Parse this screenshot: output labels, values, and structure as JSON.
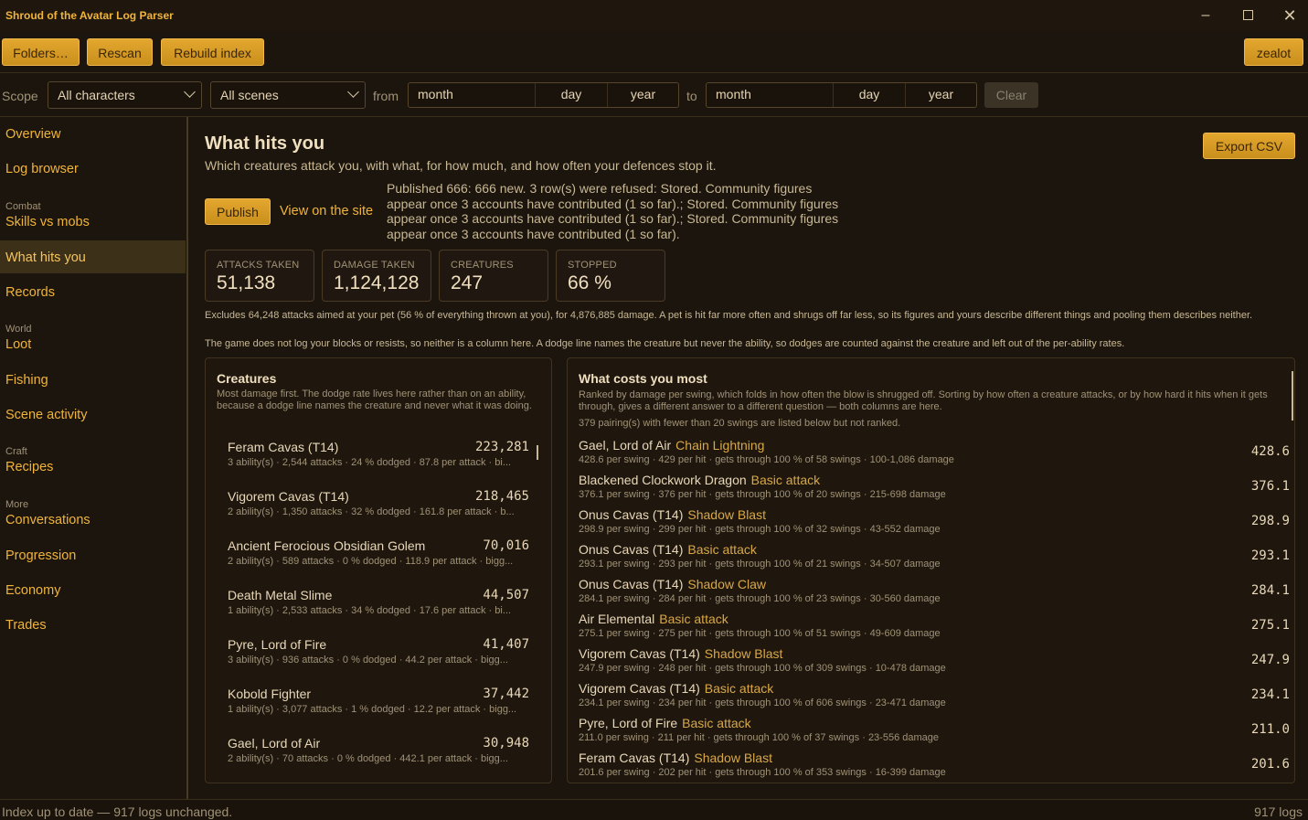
{
  "app": {
    "title": "Shroud of the Avatar Log Parser"
  },
  "toolbar": {
    "folders": "Folders…",
    "rescan": "Rescan",
    "rebuild": "Rebuild index",
    "user": "zealot"
  },
  "filters": {
    "scope_label": "Scope",
    "characters": "All characters",
    "scenes": "All scenes",
    "from_label": "from",
    "to_label": "to",
    "month": "month",
    "day": "day",
    "year": "year",
    "clear": "Clear"
  },
  "sidebar": {
    "overview": "Overview",
    "log_browser": "Log browser",
    "group_combat": "Combat",
    "skills_vs_mobs": "Skills vs mobs",
    "what_hits_you": "What hits you",
    "records": "Records",
    "group_world": "World",
    "loot": "Loot",
    "fishing": "Fishing",
    "scene_activity": "Scene activity",
    "group_craft": "Craft",
    "recipes": "Recipes",
    "group_more": "More",
    "conversations": "Conversations",
    "progression": "Progression",
    "economy": "Economy",
    "trades": "Trades"
  },
  "main": {
    "title": "What hits you",
    "subtitle": "Which creatures attack you, with what, for how much, and how often your defences stop it.",
    "export": "Export CSV",
    "publish": "Publish",
    "view_site": "View on the site",
    "publish_status": "Published 666: 666 new. 3 row(s) were refused: Stored. Community figures appear once 3 accounts have contributed (1 so far).; Stored. Community figures appear once 3 accounts have contributed (1 so far).; Stored. Community figures appear once 3 accounts have contributed (1 so far).",
    "stats": [
      {
        "k": "ATTACKS TAKEN",
        "v": "51,138"
      },
      {
        "k": "DAMAGE TAKEN",
        "v": "1,124,128"
      },
      {
        "k": "CREATURES",
        "v": "247"
      },
      {
        "k": "STOPPED",
        "v": "66 %"
      }
    ],
    "note1": "Excludes 64,248 attacks aimed at your pet (56 % of everything thrown at you), for 4,876,885 damage. A pet is hit far more often and shrugs off far less, so its figures and yours describe different things and pooling them describes neither.",
    "note2": "The game does not log your blocks or resists, so neither is a column here. A dodge line names the creature but never the ability, so dodges are counted against the creature and left out of the per-ability rates."
  },
  "creatures": {
    "title": "Creatures",
    "desc": "Most damage first. The dodge rate lives here rather than on an ability, because a dodge line names the creature and never what it was doing.",
    "rows": [
      {
        "name": "Feram Cavas (T14)",
        "value": "223,281",
        "sub": "3 ability(s) · 2,544 attacks · 24 % dodged · 87.8 per attack · bi..."
      },
      {
        "name": "Vigorem Cavas (T14)",
        "value": "218,465",
        "sub": "2 ability(s) · 1,350 attacks · 32 % dodged · 161.8 per attack · b..."
      },
      {
        "name": "Ancient Ferocious Obsidian Golem",
        "value": "70,016",
        "sub": "2 ability(s) · 589 attacks · 0 % dodged · 118.9 per attack · bigg..."
      },
      {
        "name": "Death Metal Slime",
        "value": "44,507",
        "sub": "1 ability(s) · 2,533 attacks · 34 % dodged · 17.6 per attack · bi..."
      },
      {
        "name": "Pyre, Lord of Fire",
        "value": "41,407",
        "sub": "3 ability(s) · 936 attacks · 0 % dodged · 44.2 per attack · bigg..."
      },
      {
        "name": "Kobold Fighter",
        "value": "37,442",
        "sub": "1 ability(s) · 3,077 attacks · 1 % dodged · 12.2 per attack · bigg..."
      },
      {
        "name": "Gael, Lord of Air",
        "value": "30,948",
        "sub": "2 ability(s) · 70 attacks · 0 % dodged · 442.1 per attack · bigg..."
      }
    ]
  },
  "costs": {
    "title": "What costs you most",
    "desc": "Ranked by damage per swing, which folds in how often the blow is shrugged off. Sorting by how often a creature attacks, or by how hard it hits when it gets through, gives a different answer to a different question — both columns are here.",
    "note": "379 pairing(s) with fewer than 20 swings are listed below but not ranked.",
    "rows": [
      {
        "creature": "Gael, Lord of Air",
        "ability": "Chain Lightning",
        "value": "428.6",
        "sub": "428.6 per swing · 429 per hit · gets through 100 % of 58 swings · 100-1,086 damage"
      },
      {
        "creature": "Blackened Clockwork Dragon",
        "ability": "Basic attack",
        "value": "376.1",
        "sub": "376.1 per swing · 376 per hit · gets through 100 % of 20 swings · 215-698 damage"
      },
      {
        "creature": "Onus Cavas (T14)",
        "ability": "Shadow Blast",
        "value": "298.9",
        "sub": "298.9 per swing · 299 per hit · gets through 100 % of 32 swings · 43-552 damage"
      },
      {
        "creature": "Onus Cavas (T14)",
        "ability": "Basic attack",
        "value": "293.1",
        "sub": "293.1 per swing · 293 per hit · gets through 100 % of 21 swings · 34-507 damage"
      },
      {
        "creature": "Onus Cavas (T14)",
        "ability": "Shadow Claw",
        "value": "284.1",
        "sub": "284.1 per swing · 284 per hit · gets through 100 % of 23 swings · 30-560 damage"
      },
      {
        "creature": "Air Elemental",
        "ability": "Basic attack",
        "value": "275.1",
        "sub": "275.1 per swing · 275 per hit · gets through 100 % of 51 swings · 49-609 damage"
      },
      {
        "creature": "Vigorem Cavas (T14)",
        "ability": "Shadow Blast",
        "value": "247.9",
        "sub": "247.9 per swing · 248 per hit · gets through 100 % of 309 swings · 10-478 damage"
      },
      {
        "creature": "Vigorem Cavas (T14)",
        "ability": "Basic attack",
        "value": "234.1",
        "sub": "234.1 per swing · 234 per hit · gets through 100 % of 606 swings · 23-471 damage"
      },
      {
        "creature": "Pyre, Lord of Fire",
        "ability": "Basic attack",
        "value": "211.0",
        "sub": "211.0 per swing · 211 per hit · gets through 100 % of 37 swings · 23-556 damage"
      },
      {
        "creature": "Feram Cavas (T14)",
        "ability": "Shadow Blast",
        "value": "201.6",
        "sub": "201.6 per swing · 202 per hit · gets through 100 % of 353 swings · 16-399 damage"
      }
    ]
  },
  "status": {
    "left": "Index up to date — 917 logs unchanged.",
    "right": "917 logs"
  },
  "colors": {
    "accent": "#f0b43a",
    "background": "#1c150d",
    "button": "#d99e27"
  }
}
